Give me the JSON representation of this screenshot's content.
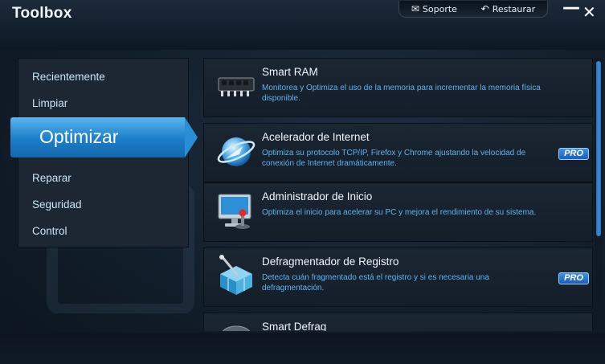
{
  "app": {
    "title": "Toolbox"
  },
  "top_bar": {
    "support_label": "Soporte",
    "restore_label": "Restaurar"
  },
  "window_controls": {
    "minimize": "—",
    "close": "✕"
  },
  "sidebar": {
    "items": [
      {
        "label": "Recientemente"
      },
      {
        "label": "Limpiar"
      },
      {
        "label": "Optimizar",
        "active": true
      },
      {
        "label": "Reparar"
      },
      {
        "label": "Seguridad"
      },
      {
        "label": "Control"
      }
    ]
  },
  "tools": [
    {
      "title": "Smart RAM",
      "description": "Monitorea y Optimiza el uso de la memoria para incrementar la memoria física disponible.",
      "icon": "ram-chip-icon",
      "pro": false
    },
    {
      "title": "Acelerador de Internet",
      "description": "Optimiza su protocolo TCP/IP, Firefox y Chrome ajustando la velocidad de conexión de Internet dramáticamente.",
      "icon": "internet-globe-icon",
      "pro": true,
      "badge": "PRO"
    },
    {
      "title": "Administrador de Inicio",
      "description": "Optimiza el inicio para acelerar su PC y mejora el rendimiento de su sistema.",
      "icon": "monitor-joystick-icon",
      "pro": false
    },
    {
      "title": "Defragmentador de Registro",
      "description": "Detecta cuán fragmentado está el registro y si es necesaria una defragmentación.",
      "icon": "registry-cube-icon",
      "pro": true,
      "badge": "PRO"
    },
    {
      "title": "Smart Defrag",
      "description": "",
      "icon": "defrag-disk-icon",
      "pro": false
    }
  ],
  "colors": {
    "accent": "#2b8dd4",
    "description_text": "#5fb3ef",
    "sidebar_text": "#c9e3f8",
    "pro_badge": "#2a74cc"
  }
}
